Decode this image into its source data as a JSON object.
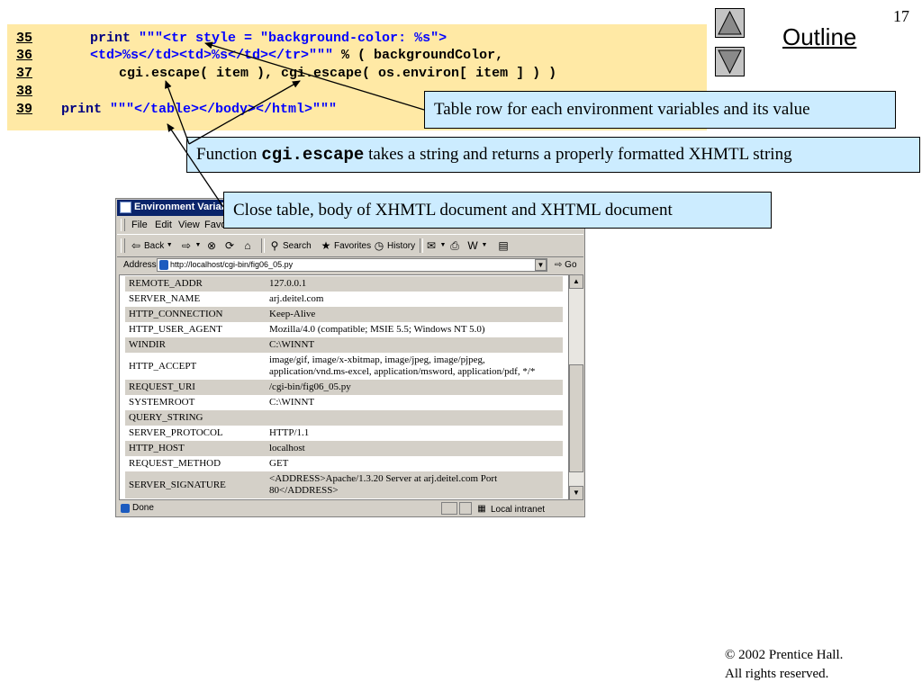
{
  "slide": {
    "number": "17",
    "outline_title": "Outline",
    "copyright_line1": "© 2002 Prentice Hall.",
    "copyright_line2": "All rights reserved."
  },
  "code": {
    "lines": [
      {
        "num": "35",
        "parts": [
          {
            "t": "print ",
            "c": "kw"
          },
          {
            "t": "\"\"\"<tr style = \"background-color: %s\">",
            "c": "str"
          }
        ]
      },
      {
        "num": "36",
        "parts": [
          {
            "t": "<td>%s</td><td>%s</td></tr>\"\"\" ",
            "c": "str"
          },
          {
            "t": "% ( backgroundColor,",
            "c": "pl"
          }
        ]
      },
      {
        "num": "37",
        "parts": [
          {
            "t": "cgi.escape( item ), cgi.escape( os.environ[ item ] ) )",
            "c": "pl"
          }
        ]
      },
      {
        "num": "38",
        "parts": []
      },
      {
        "num": "39",
        "parts": [
          {
            "t": "print ",
            "c": "kw"
          },
          {
            "t": "\"\"\"</table></body></html>\"\"\"",
            "c": "str"
          }
        ]
      }
    ]
  },
  "callouts": {
    "table_row": "Table row for each environment variables and its value",
    "escape_prefix": "Function ",
    "escape_code": "cgi.escape",
    "escape_suffix": " takes a string and returns a properly formatted XHMTL string",
    "close_table": "Close table, body of XHMTL document and XHTML document"
  },
  "browser": {
    "title": "Environment Variables",
    "menu": [
      "File",
      "Edit",
      "View",
      "Favor"
    ],
    "toolbar": {
      "back": "Back",
      "search": "Search",
      "favorites": "Favorites",
      "history": "History"
    },
    "address_label": "Address",
    "url": "http://localhost/cgi-bin/fig06_05.py",
    "go_label": "Go",
    "status_text": "Done",
    "zone_text": "Local intranet",
    "rows": [
      {
        "name": "REMOTE_ADDR",
        "value": "127.0.0.1",
        "shade": "gray"
      },
      {
        "name": "SERVER_NAME",
        "value": "arj.deitel.com",
        "shade": "white"
      },
      {
        "name": "HTTP_CONNECTION",
        "value": "Keep-Alive",
        "shade": "gray"
      },
      {
        "name": "HTTP_USER_AGENT",
        "value": "Mozilla/4.0 (compatible; MSIE 5.5; Windows NT 5.0)",
        "shade": "white"
      },
      {
        "name": "WINDIR",
        "value": "C:\\WINNT",
        "shade": "gray"
      },
      {
        "name": "HTTP_ACCEPT",
        "value": "image/gif, image/x-xbitmap, image/jpeg, image/pjpeg, application/vnd.ms-excel, application/msword, application/pdf, */*",
        "shade": "white"
      },
      {
        "name": "REQUEST_URI",
        "value": "/cgi-bin/fig06_05.py",
        "shade": "gray"
      },
      {
        "name": "SYSTEMROOT",
        "value": "C:\\WINNT",
        "shade": "white"
      },
      {
        "name": "QUERY_STRING",
        "value": "",
        "shade": "gray"
      },
      {
        "name": "SERVER_PROTOCOL",
        "value": "HTTP/1.1",
        "shade": "white"
      },
      {
        "name": "HTTP_HOST",
        "value": "localhost",
        "shade": "gray"
      },
      {
        "name": "REQUEST_METHOD",
        "value": "GET",
        "shade": "white"
      },
      {
        "name": "SERVER_SIGNATURE",
        "value": "<ADDRESS>Apache/1.3.20 Server at arj.deitel.com Port 80</ADDRESS>",
        "shade": "gray"
      }
    ]
  },
  "colors": {
    "code_background": "#ffe9a5",
    "callout_background": "#ccecff",
    "keyword": "#000080",
    "string": "#0000ff"
  },
  "icons": {
    "nav_up": "up-triangle-icon",
    "nav_down": "down-triangle-icon"
  }
}
